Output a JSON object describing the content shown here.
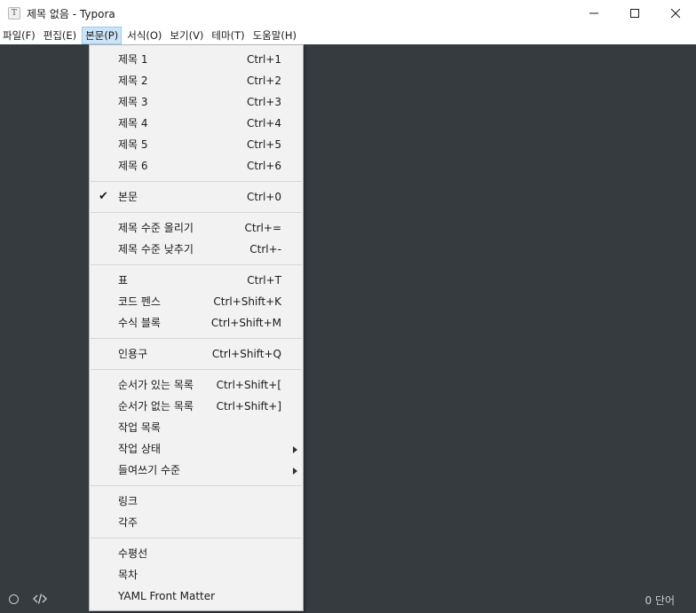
{
  "window": {
    "title": "제목 없음 - Typora",
    "app_icon": "T"
  },
  "menubar": [
    {
      "label": "파일(F)"
    },
    {
      "label": "편집(E)"
    },
    {
      "label": "본문(P)",
      "active": true
    },
    {
      "label": "서식(O)"
    },
    {
      "label": "보기(V)"
    },
    {
      "label": "테마(T)"
    },
    {
      "label": "도움말(H)"
    }
  ],
  "menu": {
    "heading1": {
      "label": "제목 1",
      "shortcut": "Ctrl+1"
    },
    "heading2": {
      "label": "제목 2",
      "shortcut": "Ctrl+2"
    },
    "heading3": {
      "label": "제목 3",
      "shortcut": "Ctrl+3"
    },
    "heading4": {
      "label": "제목 4",
      "shortcut": "Ctrl+4"
    },
    "heading5": {
      "label": "제목 5",
      "shortcut": "Ctrl+5"
    },
    "heading6": {
      "label": "제목 6",
      "shortcut": "Ctrl+6"
    },
    "paragraph": {
      "label": "본문",
      "shortcut": "Ctrl+0",
      "checked": true,
      "check_glyph": "✔"
    },
    "promote": {
      "label": "제목 수준 올리기",
      "shortcut": "Ctrl+="
    },
    "demote": {
      "label": "제목 수준 낮추기",
      "shortcut": "Ctrl+-"
    },
    "table": {
      "label": "표",
      "shortcut": "Ctrl+T"
    },
    "code_fence": {
      "label": "코드 펜스",
      "shortcut": "Ctrl+Shift+K"
    },
    "math_block": {
      "label": "수식 블록",
      "shortcut": "Ctrl+Shift+M"
    },
    "quote": {
      "label": "인용구",
      "shortcut": "Ctrl+Shift+Q"
    },
    "ordered_list": {
      "label": "순서가 있는 목록",
      "shortcut": "Ctrl+Shift+["
    },
    "unordered_list": {
      "label": "순서가 없는 목록",
      "shortcut": "Ctrl+Shift+]"
    },
    "task_list": {
      "label": "작업 목록"
    },
    "task_status": {
      "label": "작업 상태",
      "submenu": true
    },
    "list_indent": {
      "label": "들여쓰기 수준",
      "submenu": true
    },
    "link": {
      "label": "링크"
    },
    "footnote": {
      "label": "각주"
    },
    "hr": {
      "label": "수평선"
    },
    "toc": {
      "label": "목차"
    },
    "yaml": {
      "label": "YAML Front Matter"
    }
  },
  "statusbar": {
    "word_count": "0 단어"
  },
  "colors": {
    "editor_bg": "#363b40",
    "menu_bg": "#f2f2f2",
    "menubar_active": "#cce4f7"
  }
}
